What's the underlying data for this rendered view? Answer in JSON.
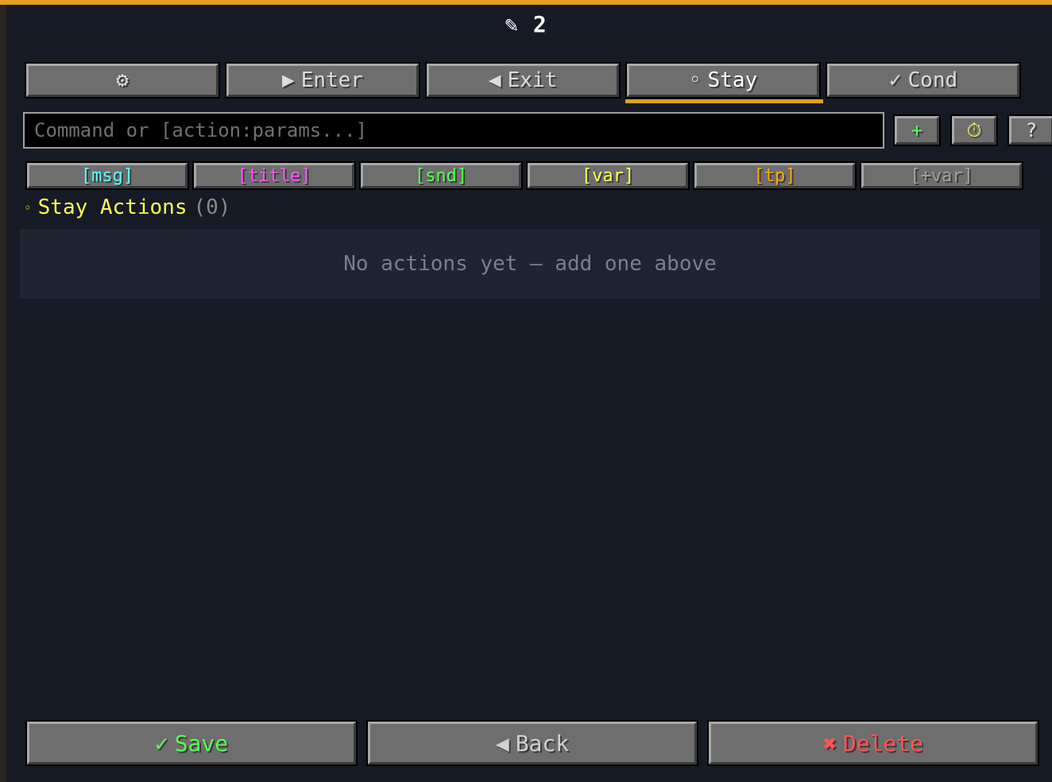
{
  "title": {
    "icon": "✎",
    "text": "2"
  },
  "tabs": [
    {
      "icon": "⚙",
      "label": ""
    },
    {
      "icon": "▶",
      "label": "Enter"
    },
    {
      "icon": "◀",
      "label": "Exit"
    },
    {
      "icon": "◦",
      "label": "Stay"
    },
    {
      "icon": "✓",
      "label": "Cond"
    }
  ],
  "active_tab": "Stay",
  "command_input": {
    "value": "",
    "placeholder": "Command or [action:params...]"
  },
  "small_buttons": {
    "add": "+",
    "timer": "⏱",
    "help": "?"
  },
  "action_chips": [
    {
      "label": "[msg]",
      "color": "#55ffff"
    },
    {
      "label": "[title]",
      "color": "#ff55ff"
    },
    {
      "label": "[snd]",
      "color": "#55ff55"
    },
    {
      "label": "[var]",
      "color": "#ffff55"
    },
    {
      "label": "[tp]",
      "color": "#ffaa00"
    },
    {
      "label": "[+var]",
      "color": "#a0a0a0"
    }
  ],
  "section": {
    "icon": "◦",
    "title": "Stay Actions",
    "count": "(0)"
  },
  "empty_message": "No actions yet — add one above",
  "bottom": {
    "save": {
      "icon": "✓",
      "label": "Save",
      "color": "#55ff55"
    },
    "back": {
      "icon": "◀",
      "label": "Back",
      "color": "#d0d0d0"
    },
    "delete": {
      "icon": "✖",
      "label": "Delete",
      "color": "#ff5555"
    }
  },
  "colors": {
    "accent": "#e0a020",
    "background": "#161a24"
  }
}
